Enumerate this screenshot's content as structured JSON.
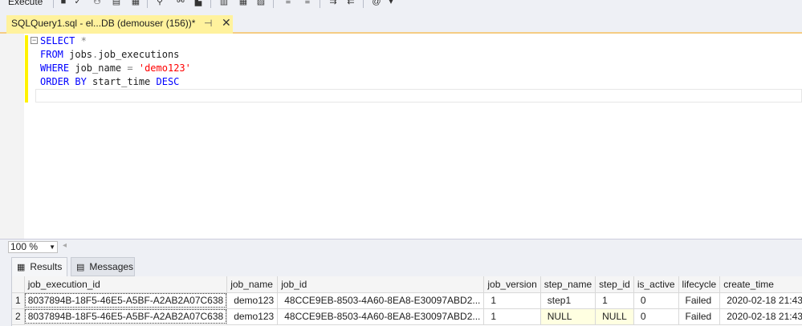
{
  "toolbar": {
    "execute_label": "Execute",
    "icons": [
      "stop-icon",
      "parse-check-icon",
      "display-plan-icon",
      "query-options-icon",
      "results-to-grid-icon",
      "comment-icon",
      "uncomment-icon",
      "indent-icon",
      "outdent-icon",
      "specify-values-icon"
    ]
  },
  "document_tab": {
    "title": "SQLQuery1.sql - el...DB (demouser (156))*",
    "pin_glyph": "⊣",
    "close_glyph": "✕"
  },
  "editor": {
    "fold_glyph": "−",
    "lines": [
      [
        {
          "t": "SELECT",
          "c": "kw"
        },
        {
          "t": " ",
          "c": ""
        },
        {
          "t": "*",
          "c": "op"
        }
      ],
      [
        {
          "t": "FROM",
          "c": "kw"
        },
        {
          "t": " jobs",
          "c": ""
        },
        {
          "t": ".",
          "c": "op"
        },
        {
          "t": "job_executions",
          "c": ""
        }
      ],
      [
        {
          "t": "WHERE",
          "c": "kw"
        },
        {
          "t": " job_name ",
          "c": ""
        },
        {
          "t": "=",
          "c": "op"
        },
        {
          "t": " ",
          "c": ""
        },
        {
          "t": "'demo123'",
          "c": "str"
        }
      ],
      [
        {
          "t": "ORDER BY",
          "c": "kw"
        },
        {
          "t": " start_time ",
          "c": ""
        },
        {
          "t": "DESC",
          "c": "kw"
        }
      ],
      [
        {
          "t": "",
          "c": ""
        }
      ]
    ]
  },
  "zoom": {
    "value": "100 %"
  },
  "result_tabs": [
    {
      "label": "Results",
      "icon": "grid-icon",
      "active": true
    },
    {
      "label": "Messages",
      "icon": "messages-icon",
      "active": false
    }
  ],
  "grid": {
    "columns": [
      "",
      "job_execution_id",
      "job_name",
      "job_id",
      "job_version",
      "step_name",
      "step_id",
      "is_active",
      "lifecycle",
      "create_time"
    ],
    "rows": [
      [
        "1",
        "8037894B-18F5-46E5-A5BF-A2AB2A07C638",
        "demo123",
        "48CCE9EB-8503-4A60-8EA8-E30097ABD2...",
        "1",
        "step1",
        "1",
        "0",
        "Failed",
        "2020-02-18 21:43"
      ],
      [
        "2",
        "8037894B-18F5-46E5-A5BF-A2AB2A07C638",
        "demo123",
        "48CCE9EB-8503-4A60-8EA8-E30097ABD2...",
        "1",
        "NULL",
        "NULL",
        "0",
        "Failed",
        "2020-02-18 21:43"
      ]
    ]
  }
}
